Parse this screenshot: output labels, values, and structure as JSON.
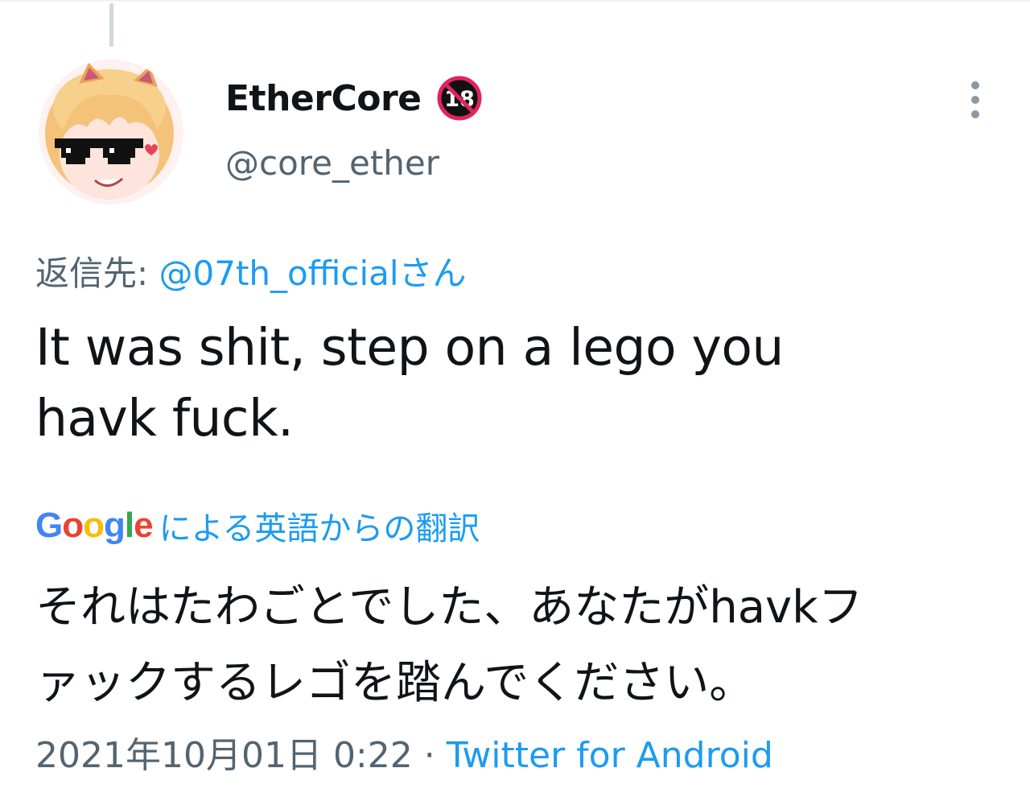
{
  "tweet": {
    "display_name": "EtherCore",
    "badge_text": "18",
    "handle": "@core_ether",
    "replying_prefix": "返信先: ",
    "replying_to": "@07th_officialさん",
    "text_line1": "It was shit, step on a lego you",
    "text_line2": "havk fuck.",
    "translation": {
      "provider": "Google",
      "label": "による英語からの翻訳",
      "text_line1": "それはたわごとでした、あなたがhavkフ",
      "text_line2": "ァックするレゴを踏んでください。"
    },
    "timestamp": "2021年10月01日 0:22",
    "separator": " · ",
    "source": "Twitter for Android"
  },
  "icons": {
    "more": "more-vertical-icon",
    "badge": "no-under-18-icon",
    "avatar": "avatar-anime-girl"
  },
  "colors": {
    "link": "#1d9bf0",
    "secondary_text": "#536471",
    "primary_text": "#0f1419",
    "thread_line": "#cfd9de",
    "google_blue": "#4285f4",
    "google_red": "#ea4335",
    "google_yellow": "#fbbc05",
    "google_green": "#34a853"
  }
}
